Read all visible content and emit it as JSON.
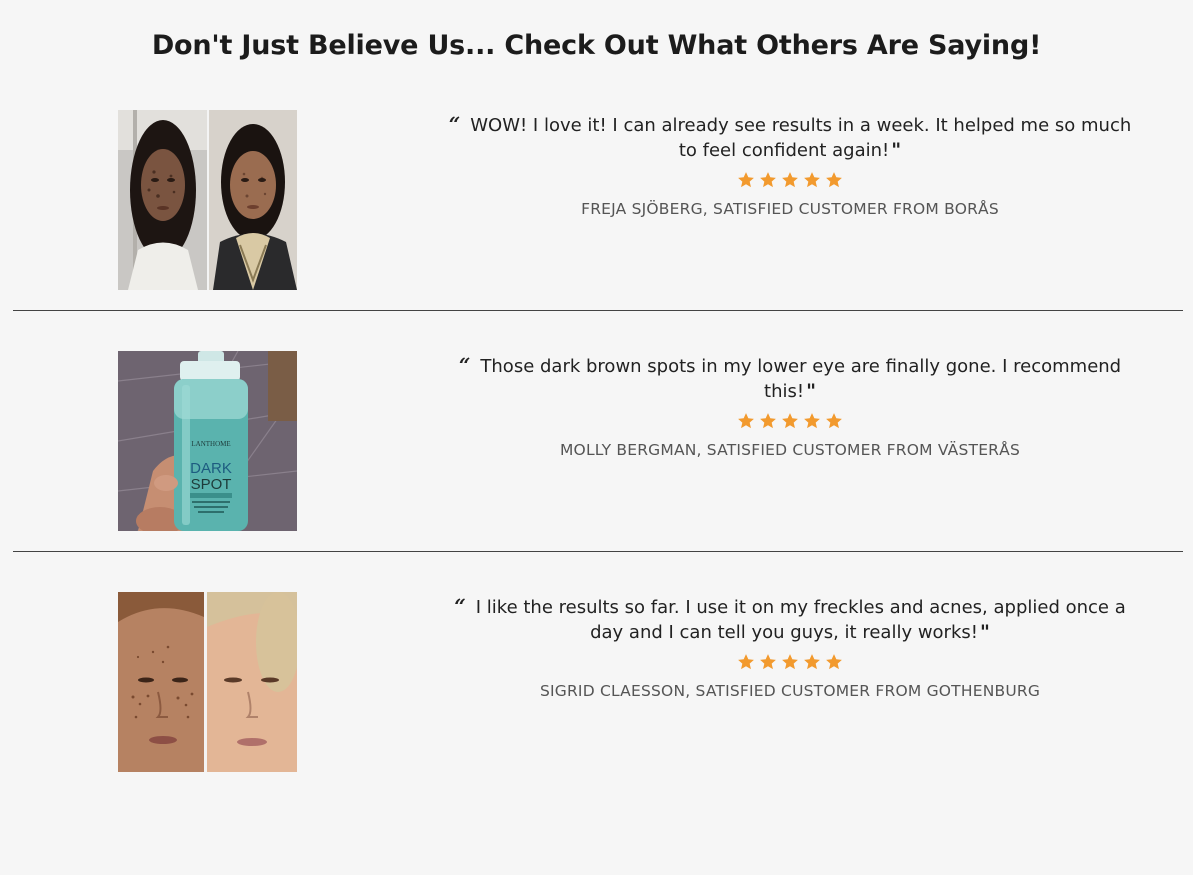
{
  "heading": "Don't Just Believe Us... Check Out What Others Are Saying!",
  "star_color": "#f29a2e",
  "reviews": [
    {
      "quote": "WOW! I love it! I can already see results in a week. It helped me so much to feel confident again!",
      "rating": 5,
      "author": "FREJA SJÖBERG, SATISFIED CUSTOMER FROM BORÅS",
      "photo": "before-after-face-photo"
    },
    {
      "quote": "Those dark brown spots in my lower eye are finally gone. I recommend this!",
      "rating": 5,
      "author": "MOLLY BERGMAN, SATISFIED CUSTOMER FROM VÄSTERÅS",
      "photo": "product-bottle-photo",
      "product_label": {
        "brand": "LANTHOME",
        "line1": "DARK",
        "line2": "SPOT"
      }
    },
    {
      "quote": "I like the results so far. I use it on my freckles and acnes, applied once a day and I can tell you guys, it really works!",
      "rating": 5,
      "author": "SIGRID CLAESSON, SATISFIED CUSTOMER FROM GOTHENBURG",
      "photo": "before-after-face-photo"
    }
  ],
  "open_quote_mark": "“",
  "close_quote_mark": "\""
}
